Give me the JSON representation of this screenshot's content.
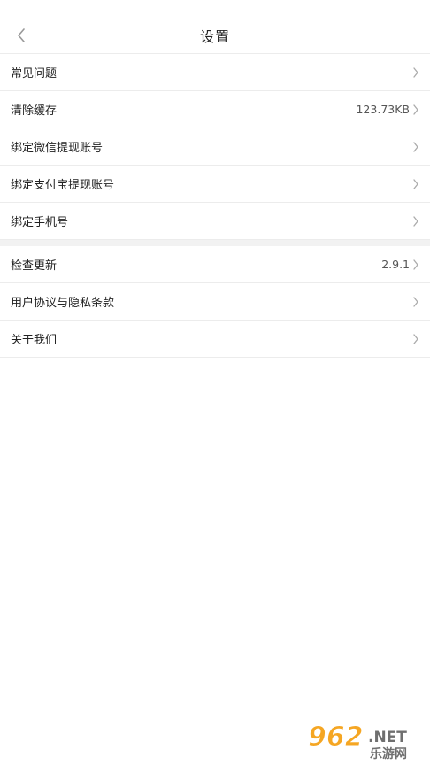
{
  "header": {
    "title": "设置"
  },
  "groups": [
    {
      "items": [
        {
          "label": "常见问题",
          "value": ""
        },
        {
          "label": "清除缓存",
          "value": "123.73KB"
        },
        {
          "label": "绑定微信提现账号",
          "value": ""
        },
        {
          "label": "绑定支付宝提现账号",
          "value": ""
        },
        {
          "label": "绑定手机号",
          "value": ""
        }
      ]
    },
    {
      "items": [
        {
          "label": "检查更新",
          "value": "2.9.1"
        },
        {
          "label": "用户协议与隐私条款",
          "value": ""
        },
        {
          "label": "关于我们",
          "value": ""
        }
      ]
    }
  ],
  "watermark": {
    "text": "962.NET 乐游网"
  },
  "colors": {
    "divider": "#ececec",
    "group_gap": "#f2f2f2",
    "chevron": "#aaaaaa"
  },
  "icons": {
    "back": "chevron-left-icon",
    "row": "chevron-right-icon"
  }
}
